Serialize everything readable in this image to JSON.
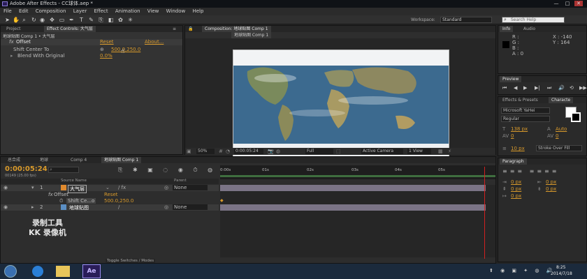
{
  "window": {
    "title": "Adobe After Effects - CC球体.aep *",
    "min": "—",
    "max": "□",
    "close": "✕"
  },
  "menu": [
    "File",
    "Edit",
    "Composition",
    "Layer",
    "Effect",
    "Animation",
    "View",
    "Window",
    "Help"
  ],
  "toolbar": {
    "workspace_label": "Workspace:",
    "workspace_value": "Standard",
    "search_placeholder": "Search Help"
  },
  "project_panel": {
    "tab_project": "Project",
    "tab_effect_controls": "Effect Controls: 大气层",
    "breadcrumb": "地球贴图 Comp 1 • 大气层",
    "effect": {
      "fx": "fx",
      "name": "Offset",
      "reset": "Reset",
      "about": "About...",
      "prop1": "Shift Center To",
      "prop1_value": "500.0,250.0",
      "prop2": "Blend With Original",
      "prop2_value": "0.0%"
    }
  },
  "comp_panel": {
    "tab": "Composition: 地球贴图 Comp 1",
    "subtab": "地球贴图 Comp 1",
    "zoom": "50%",
    "timecode": "0:00:05:24",
    "resolution": "Full",
    "camera": "Active Camera",
    "views": "1 View"
  },
  "info_panel": {
    "tab_info": "Info",
    "tab_audio": "Audio",
    "r": "R :",
    "g": "G :",
    "b": "B :",
    "a": "A : 0",
    "x": "X : -140",
    "y": "Y : 164"
  },
  "preview_panel": {
    "tab": "Preview"
  },
  "character_panel": {
    "tab_effects": "Effects & Presets",
    "tab_character": "Characte",
    "font": "Microsoft YaHei",
    "style": "Regular",
    "size": "138 px",
    "leading": "Auto",
    "kerning": "0",
    "tracking": "0",
    "stroke": "10 px",
    "stroke_mode": "Stroke Over Fill"
  },
  "paragraph_panel": {
    "tab": "Paragraph",
    "px1": "0 px",
    "px2": "0 px",
    "px3": "0 px",
    "px4": "0 px",
    "px5": "0 px"
  },
  "timeline": {
    "tabs": [
      "总合成",
      "地球",
      "Comp 4",
      "地球贴图 Comp 1"
    ],
    "timecode": "0:00:05:24",
    "fps": "00149 (25.00 fps)",
    "source_header": "Source Name",
    "parent_header": "Parent",
    "layers": [
      {
        "num": "1",
        "name": "大气层",
        "parent": "None"
      },
      {
        "num": "2",
        "name": "地球贴图",
        "parent": "None"
      }
    ],
    "effect_row": {
      "name": "Offset",
      "reset": "Reset",
      "sub": "Shift Ce...o",
      "value": "500.0,250.0"
    },
    "ruler": [
      "0:00s",
      "01s",
      "02s",
      "03s",
      "04s",
      "05s"
    ],
    "toggle": "Toggle Switches / Modes"
  },
  "watermark": {
    "line1": "录制工具",
    "line2": "KK 录像机"
  },
  "taskbar": {
    "time": "8:25",
    "date": "2014/7/18",
    "ae_label": "Ae"
  }
}
